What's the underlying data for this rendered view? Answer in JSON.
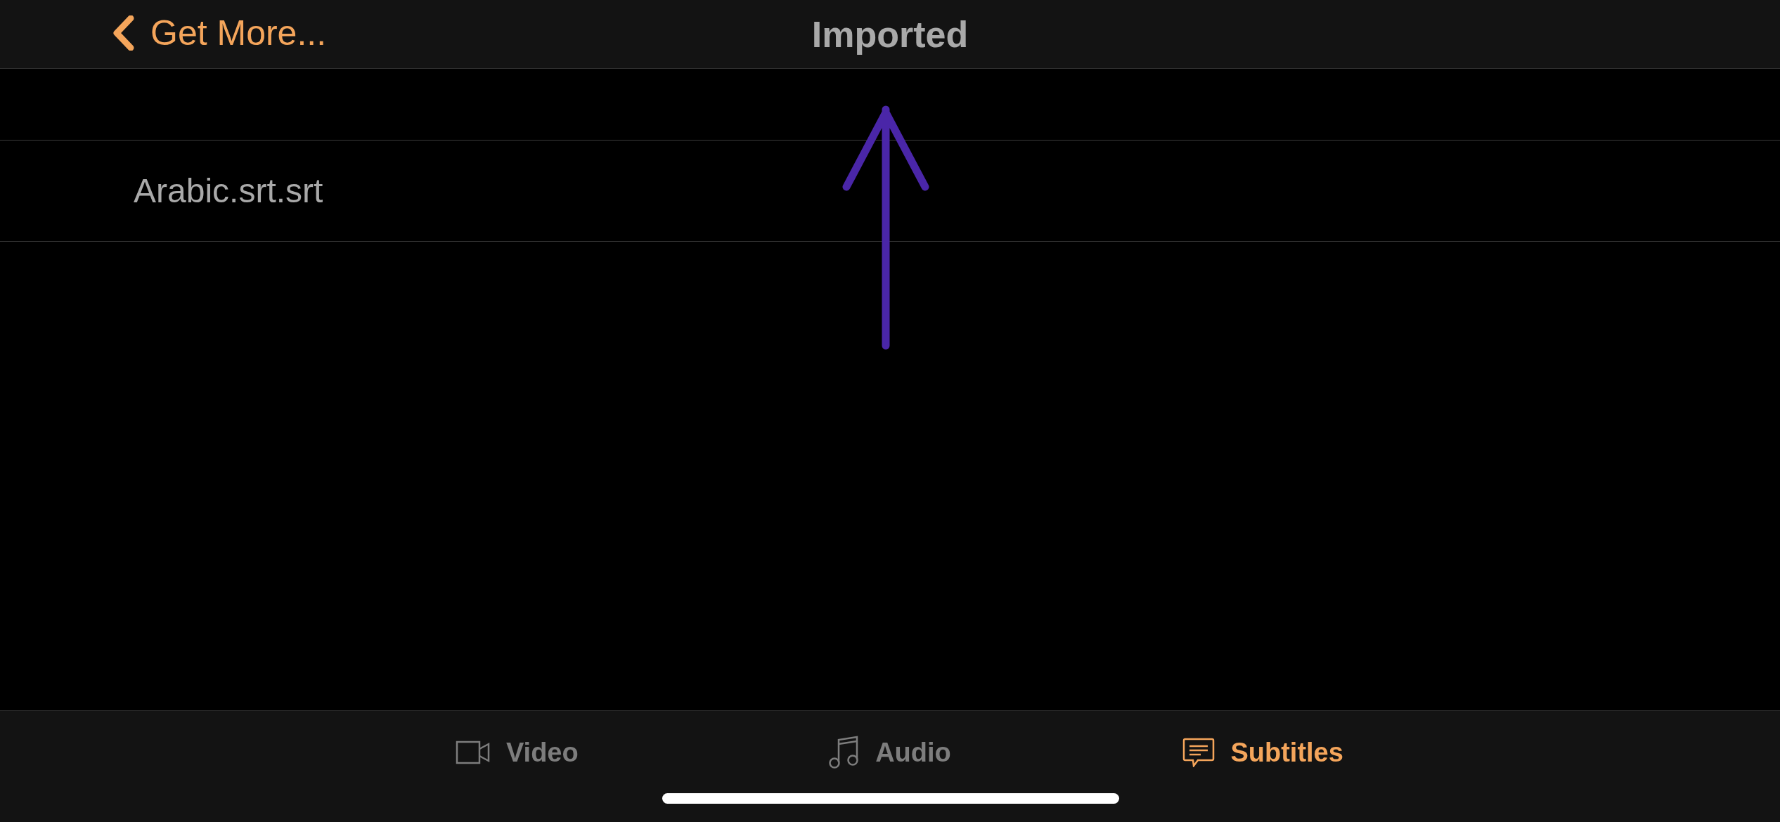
{
  "nav_bar": {
    "back_label": "Get More...",
    "title": "Imported"
  },
  "files": [
    {
      "name": "Arabic.srt.srt"
    }
  ],
  "tab_bar": [
    {
      "kind": "video",
      "label": "Video",
      "selected": false
    },
    {
      "kind": "audio",
      "label": "Audio",
      "selected": false
    },
    {
      "kind": "subtitles",
      "label": "Subtitles",
      "selected": true
    }
  ]
}
